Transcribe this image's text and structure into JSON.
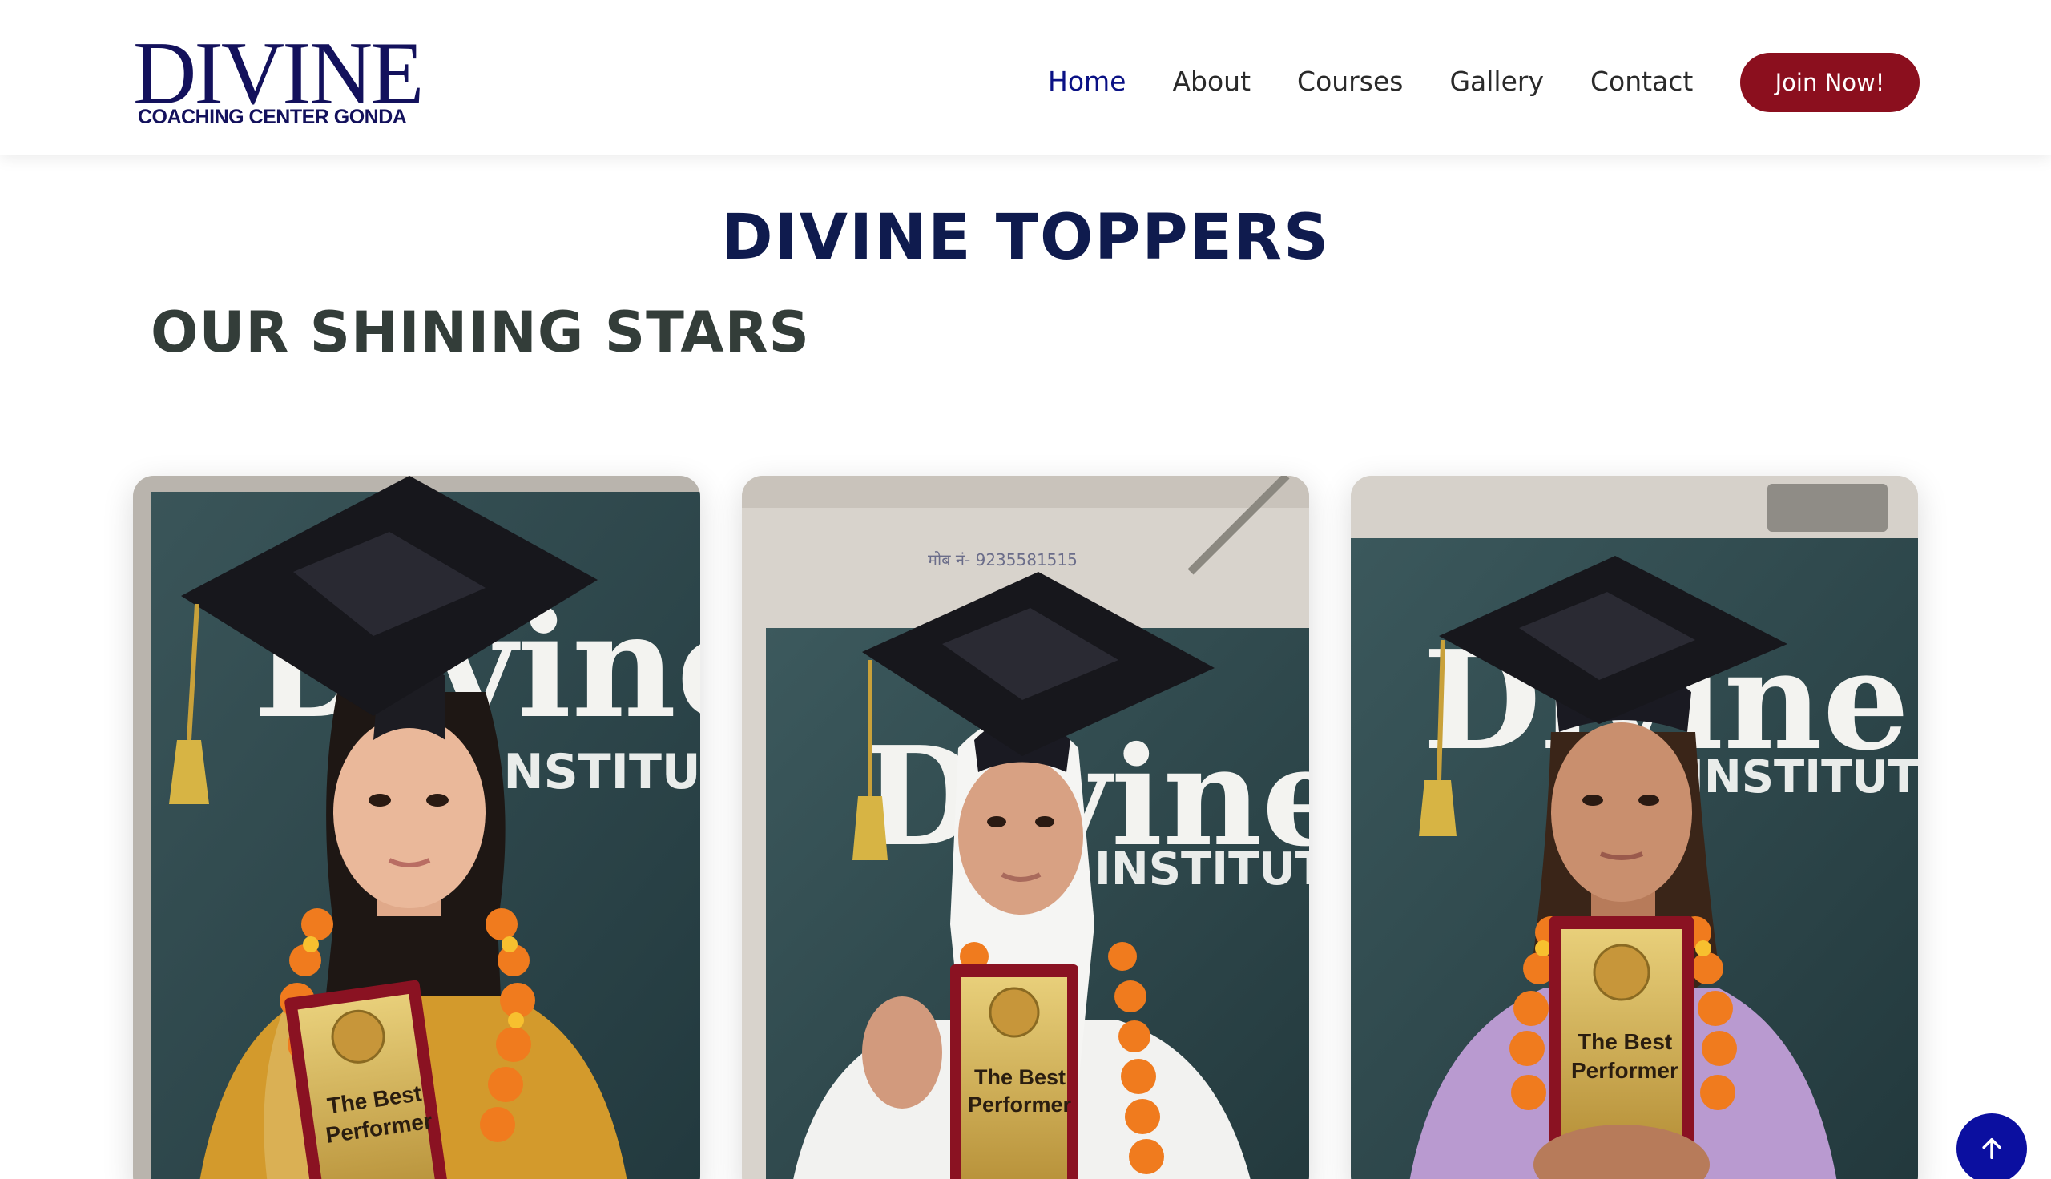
{
  "brand": {
    "name": "DIVINE",
    "tagline": "COACHING CENTER GONDA"
  },
  "nav": {
    "items": [
      {
        "label": "Home",
        "active": true
      },
      {
        "label": "About",
        "active": false
      },
      {
        "label": "Courses",
        "active": false
      },
      {
        "label": "Gallery",
        "active": false
      },
      {
        "label": "Contact",
        "active": false
      }
    ],
    "cta_label": "Join Now!"
  },
  "section": {
    "title": "DIVINE TOPPERS",
    "subtitle": "OUR SHINING STARS"
  },
  "toppers": [
    {
      "backdrop_word": "Divine",
      "backdrop_sub": "INSTITUTE",
      "award_line1": "The Best",
      "award_line2": "Performer",
      "outfit": "mustard"
    },
    {
      "backdrop_word": "Divine",
      "backdrop_sub": "INSTITUTE",
      "award_line1": "The Best",
      "award_line2": "Performer",
      "outfit": "white",
      "wall_text": "मोब नं- 9235581515"
    },
    {
      "backdrop_word": "Divine",
      "backdrop_sub": "INSTITUTE",
      "award_line1": "The Best",
      "award_line2": "Performer",
      "outfit": "lavender"
    }
  ],
  "colors": {
    "brand_navy": "#13115c",
    "nav_active": "#0a1185",
    "cta_bg": "#8b0f1e",
    "title": "#0f1b4e",
    "subtitle": "#333d39",
    "scroll_top_bg": "#0b0fa0"
  },
  "icons": {
    "scroll_top": "arrow-up-icon"
  }
}
